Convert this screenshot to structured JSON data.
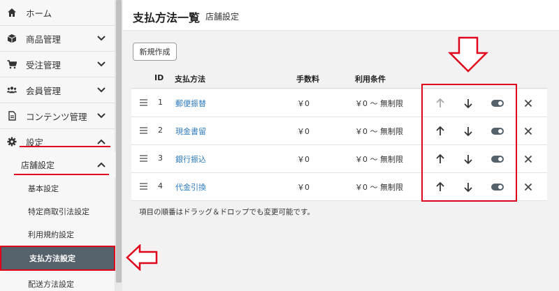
{
  "sidebar": {
    "items": [
      {
        "label": "ホーム",
        "icon": "home-icon"
      },
      {
        "label": "商品管理",
        "icon": "box-icon"
      },
      {
        "label": "受注管理",
        "icon": "cart-icon"
      },
      {
        "label": "会員管理",
        "icon": "users-icon"
      },
      {
        "label": "コンテンツ管理",
        "icon": "file-icon"
      },
      {
        "label": "設定",
        "icon": "gear-icon"
      }
    ],
    "submenu": {
      "label": "店舗設定"
    },
    "leaves": [
      {
        "label": "基本設定"
      },
      {
        "label": "特定商取引法設定"
      },
      {
        "label": "利用規約設定"
      },
      {
        "label": "支払方法設定"
      },
      {
        "label": "配送方法設定"
      }
    ]
  },
  "header": {
    "title": "支払方法一覧",
    "subtitle": "店舗設定"
  },
  "new_button": "新規作成",
  "table": {
    "headers": {
      "id": "ID",
      "method": "支払方法",
      "fee": "手数料",
      "condition": "利用条件"
    },
    "rows": [
      {
        "id": "1",
        "method": "郵便振替",
        "fee": "￥0",
        "condition": "￥0 〜 無制限"
      },
      {
        "id": "2",
        "method": "現金書留",
        "fee": "￥0",
        "condition": "￥0 〜 無制限"
      },
      {
        "id": "3",
        "method": "銀行振込",
        "fee": "￥0",
        "condition": "￥0 〜 無制限"
      },
      {
        "id": "4",
        "method": "代金引換",
        "fee": "￥0",
        "condition": "￥0 〜 無制限"
      }
    ]
  },
  "note": "項目の順番はドラッグ＆ドロップでも変更可能です。",
  "colors": {
    "accent": "#e0001b",
    "link": "#2d7bbf",
    "active_bg": "#55616b"
  }
}
